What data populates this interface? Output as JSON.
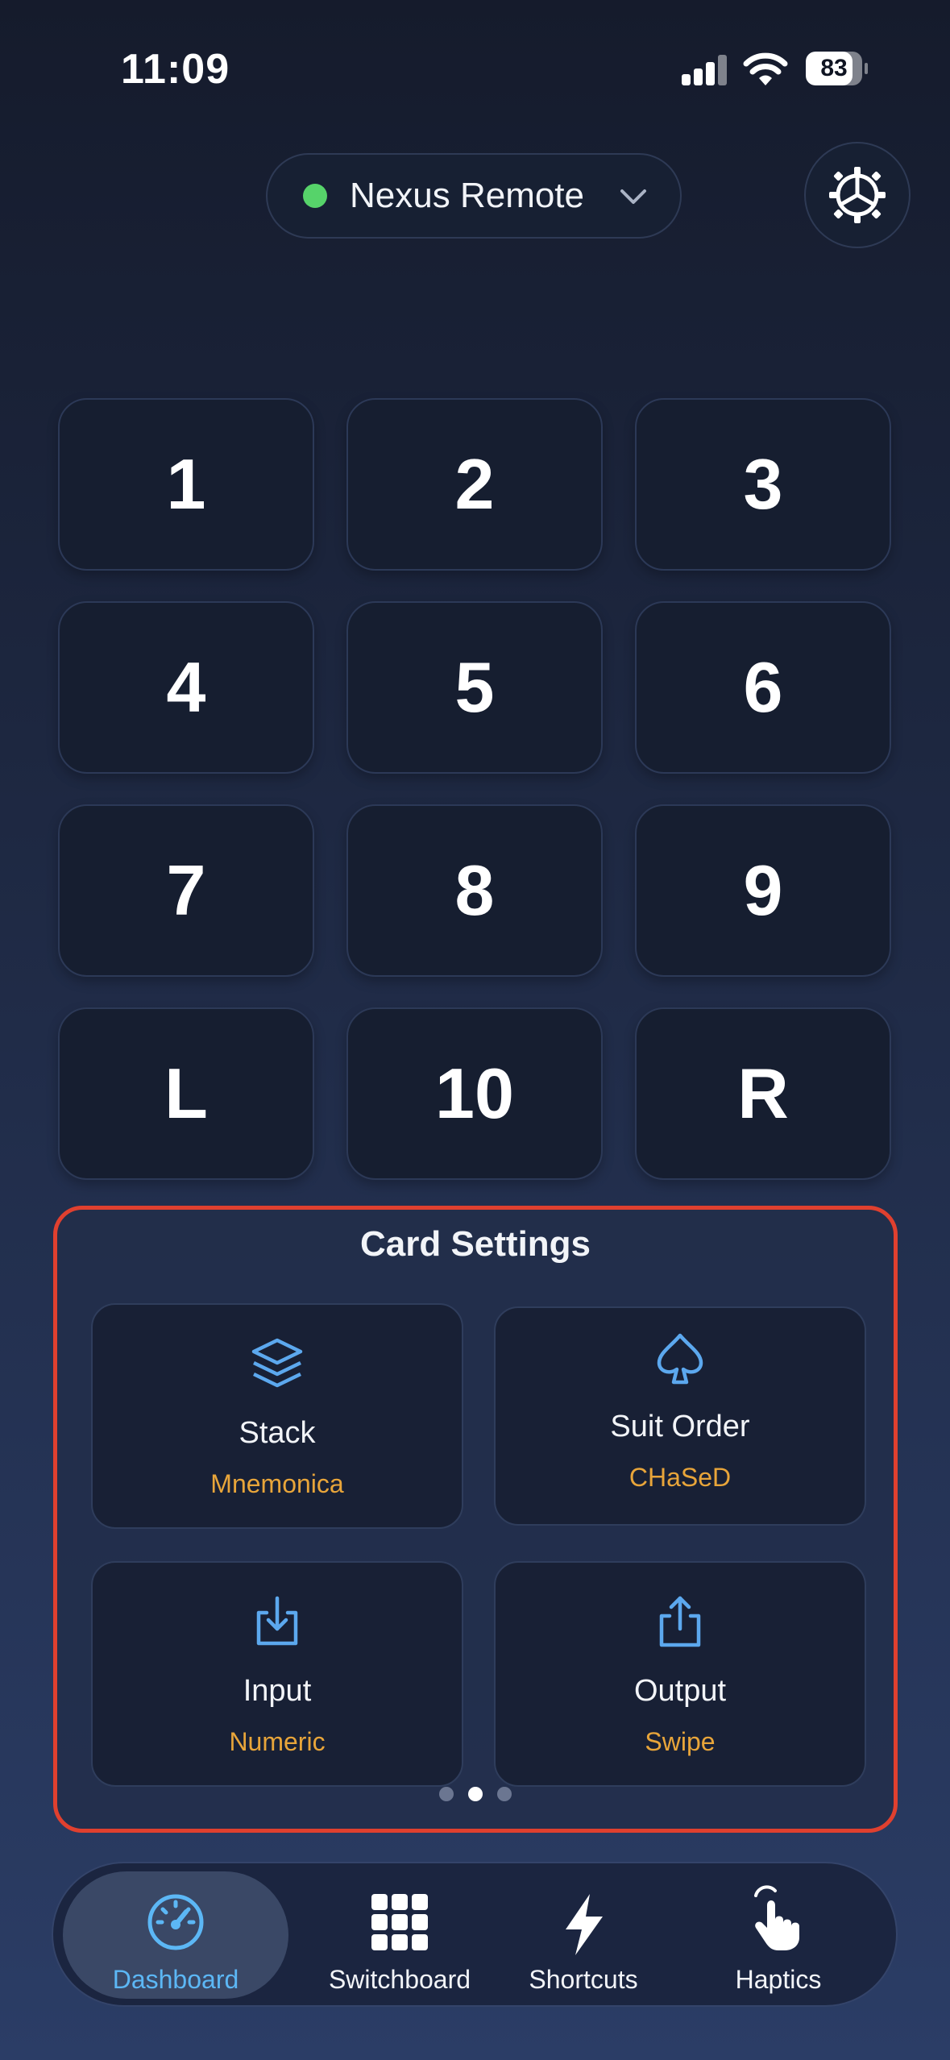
{
  "status_bar": {
    "time": "11:09",
    "battery_level": "83",
    "battery_fraction": 0.83,
    "signal_bars_active": 3
  },
  "device": {
    "name": "Nexus Remote",
    "connected_color": "#56d36a"
  },
  "keypad": {
    "keys": [
      {
        "label": "1"
      },
      {
        "label": "2"
      },
      {
        "label": "3"
      },
      {
        "label": "4"
      },
      {
        "label": "5"
      },
      {
        "label": "6"
      },
      {
        "label": "7"
      },
      {
        "label": "8"
      },
      {
        "label": "9"
      },
      {
        "label": "L"
      },
      {
        "label": "10"
      },
      {
        "label": "R"
      }
    ]
  },
  "card_settings": {
    "title": "Card Settings",
    "tiles": [
      {
        "icon": "layers-icon",
        "label": "Stack",
        "value": "Mnemonica"
      },
      {
        "icon": "spade-icon",
        "label": "Suit Order",
        "value": "CHaSeD"
      },
      {
        "icon": "download-icon",
        "label": "Input",
        "value": "Numeric"
      },
      {
        "icon": "share-icon",
        "label": "Output",
        "value": "Swipe"
      }
    ],
    "page_count": 3,
    "active_page": 2,
    "highlight_color": "#e0402f",
    "value_color": "#e8a53a"
  },
  "tab_bar": {
    "tabs": [
      {
        "icon": "speedometer-icon",
        "label": "Dashboard",
        "active": true
      },
      {
        "icon": "grid-icon",
        "label": "Switchboard",
        "active": false
      },
      {
        "icon": "lightning-icon",
        "label": "Shortcuts",
        "active": false
      },
      {
        "icon": "tap-hand-icon",
        "label": "Haptics",
        "active": false
      }
    ],
    "accent_color": "#5cb7f5"
  }
}
